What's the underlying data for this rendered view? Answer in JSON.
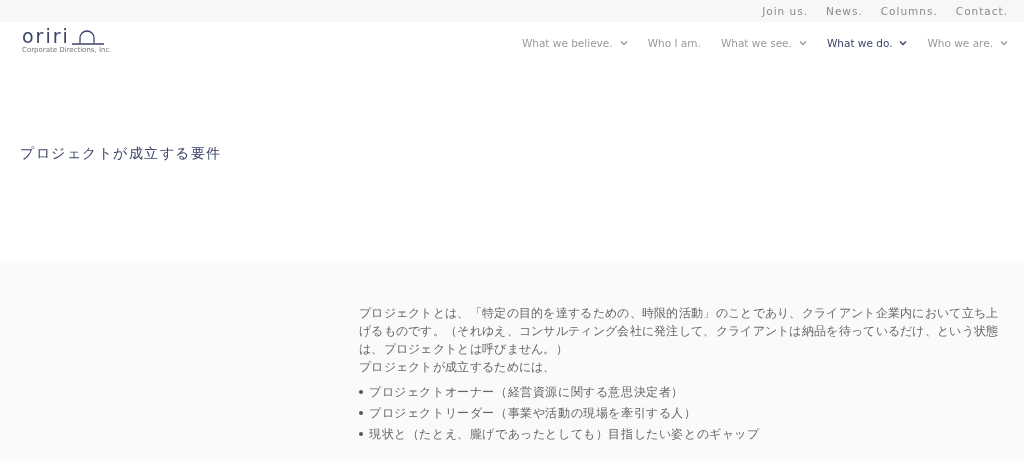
{
  "top_links": [
    {
      "label": "Join us."
    },
    {
      "label": "News."
    },
    {
      "label": "Columns."
    },
    {
      "label": "Contact."
    }
  ],
  "logo": {
    "name": "oriri",
    "tagline": "Corporate Directions, Inc."
  },
  "nav": [
    {
      "label": "What we believe.",
      "has_menu": true,
      "selected": false
    },
    {
      "label": "Who I am.",
      "has_menu": false,
      "selected": false
    },
    {
      "label": "What we see.",
      "has_menu": true,
      "selected": false
    },
    {
      "label": "What we do.",
      "has_menu": true,
      "selected": true
    },
    {
      "label": "Who we are.",
      "has_menu": true,
      "selected": false
    }
  ],
  "heading": "プロジェクトが成立する要件",
  "body": {
    "paragraphs": [
      "プロジェクトとは、「特定の目的を達するための、時限的活動」のことであり、クライアント企業内において立ち上げるものです。（それゆえ、コンサルティング会社に発注して、クライアントは納品を待っているだけ、という状態は、プロジェクトとは呼びません。）",
      "プロジェクトが成立するためには、"
    ],
    "bullets": [
      "プロジェクトオーナー（経営資源に関する意思決定者）",
      "プロジェクトリーダー（事業や活動の現場を牽引する人）",
      "現状と（たとえ、朧げであったとしても）目指したい姿とのギャップ"
    ]
  }
}
